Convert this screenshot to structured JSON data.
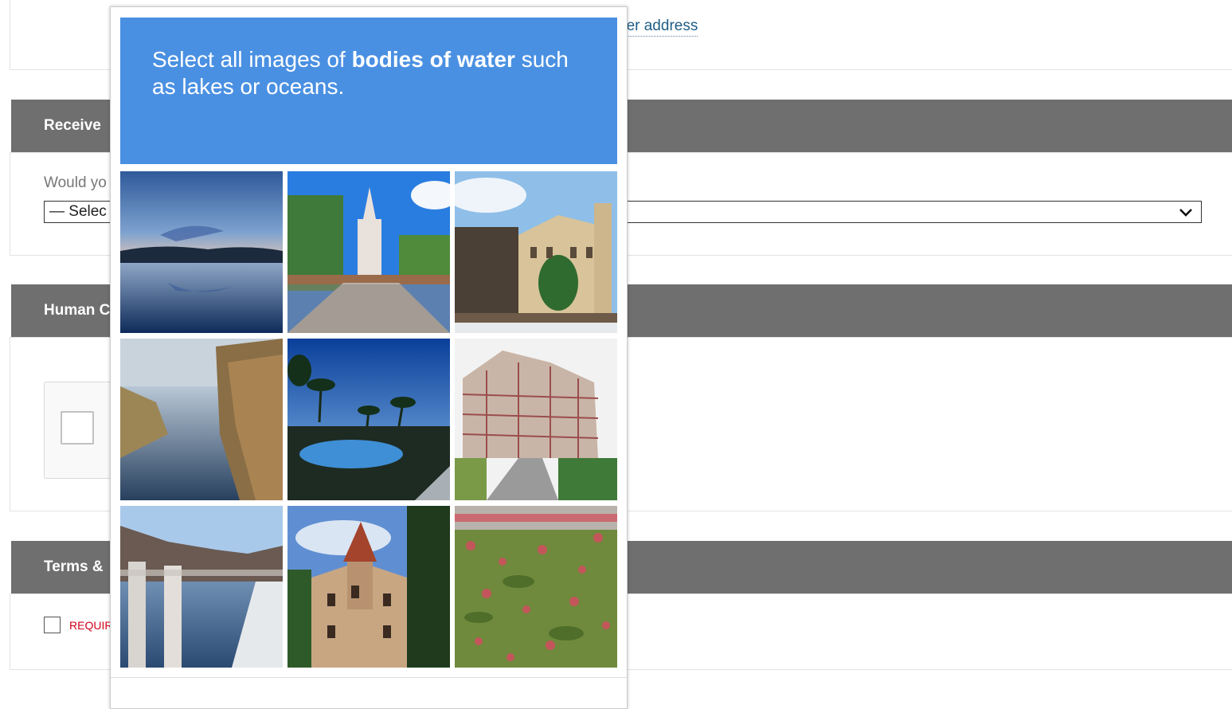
{
  "page": {
    "other_address_link": "her address",
    "sections": {
      "receive_title": "Receive",
      "human_title": "Human C",
      "terms_title": "Terms &"
    },
    "question": "Would yo",
    "select_value": "— Selec",
    "required_label": "REQUIR"
  },
  "captcha": {
    "prompt_prefix": "Select all images of ",
    "prompt_bold": "bodies of water",
    "prompt_suffix": " such as lakes or oceans.",
    "header_color": "#4a90e2",
    "tiles": [
      {
        "icon": "lake-at-dusk-image"
      },
      {
        "icon": "church-square-image"
      },
      {
        "icon": "old-building-image"
      },
      {
        "icon": "river-with-reeds-image"
      },
      {
        "icon": "palm-pool-image"
      },
      {
        "icon": "timbered-building-image"
      },
      {
        "icon": "dam-reservoir-image"
      },
      {
        "icon": "castle-villa-image"
      },
      {
        "icon": "flower-garden-image"
      }
    ]
  }
}
